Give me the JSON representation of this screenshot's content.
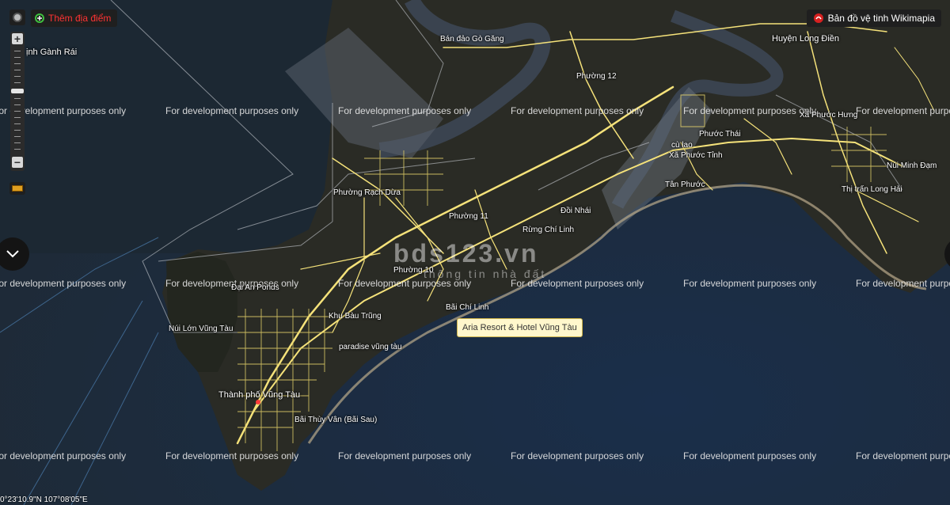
{
  "toolbar": {
    "add_place_label": "Thêm địa điểm",
    "satellite_label": "Bản đồ vệ tinh Wikimapia"
  },
  "watermark": {
    "text": "For development purposes only"
  },
  "places": [
    "ịnh Gành Rái",
    "Bán đảo Gò Găng",
    "Huyện Long Điền",
    "Phường 12",
    "Xã Phước Hưng",
    "Phước Thái",
    "cù lao",
    "Xã Phước Tỉnh",
    "Núi Minh Đạm",
    "Tân Phước",
    "Thị trấn Long Hải",
    "Phường Rạch Dừa",
    "Phường 11",
    "Đồi Nhái",
    "Rừng Chí Linh",
    "Phường 10",
    "Đại An Ponds",
    "Khu Bàu Trũng",
    "Bãi Chí Linh",
    "Núi Lớn Vũng Tàu",
    "paradise vũng tàu",
    "Thành phố Vũng Tàu",
    "Bãi Thùy Vân (Bãi Sau)"
  ],
  "tooltip": "Aria Resort & Hotel Vũng Tàu",
  "logo": {
    "main": "bds123.vn",
    "sub": "thông tin nhà đất"
  },
  "coordinates": "0°23'10.9\"N 107°08'05\"E",
  "colors": {
    "road": "#f5e27a",
    "land": "#2a2a24",
    "sea": "#1d3047",
    "outline": "#c8ccd2"
  },
  "icons": [
    "gear-icon",
    "add-place-icon",
    "satellite-logo-icon",
    "ruler-icon",
    "chevron-down-icon",
    "zoom-in-icon",
    "zoom-out-icon"
  ]
}
